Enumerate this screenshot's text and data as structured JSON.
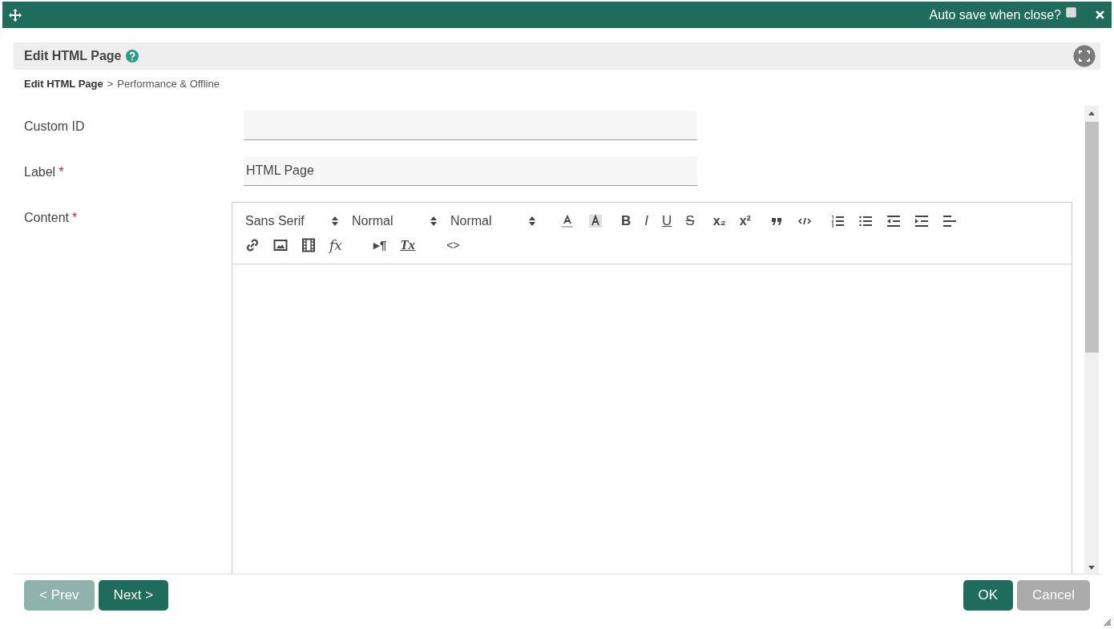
{
  "title_bar": {
    "auto_save_label": "Auto save when close?",
    "auto_save_checked": false
  },
  "panel": {
    "title": "Edit HTML Page"
  },
  "breadcrumb": {
    "current": "Edit HTML Page",
    "separator": ">",
    "step": "Performance & Offline"
  },
  "fields": [
    {
      "label": "Custom ID"
    },
    {
      "label": "Label",
      "required_mark": "*",
      "value": "HTML Page"
    }
  ],
  "content": {
    "label": "Content",
    "required_mark": "*",
    "pickers": [
      "Sans Serif",
      "Normal",
      "Normal"
    ],
    "format_buttons": [
      "B",
      "I",
      "U",
      "S"
    ],
    "script_buttons": [
      "x₂",
      "x²"
    ],
    "formula_button": "fx",
    "direction_button": "▸¶",
    "clear_button": "Tx",
    "source_button": "<>"
  },
  "footer": {
    "prev": {
      "label": "< Prev",
      "disabled": true
    },
    "next": {
      "label": "Next >",
      "disabled": false
    },
    "ok": {
      "label": "OK",
      "disabled": false
    },
    "cancel": {
      "label": "Cancel",
      "disabled": true
    }
  }
}
